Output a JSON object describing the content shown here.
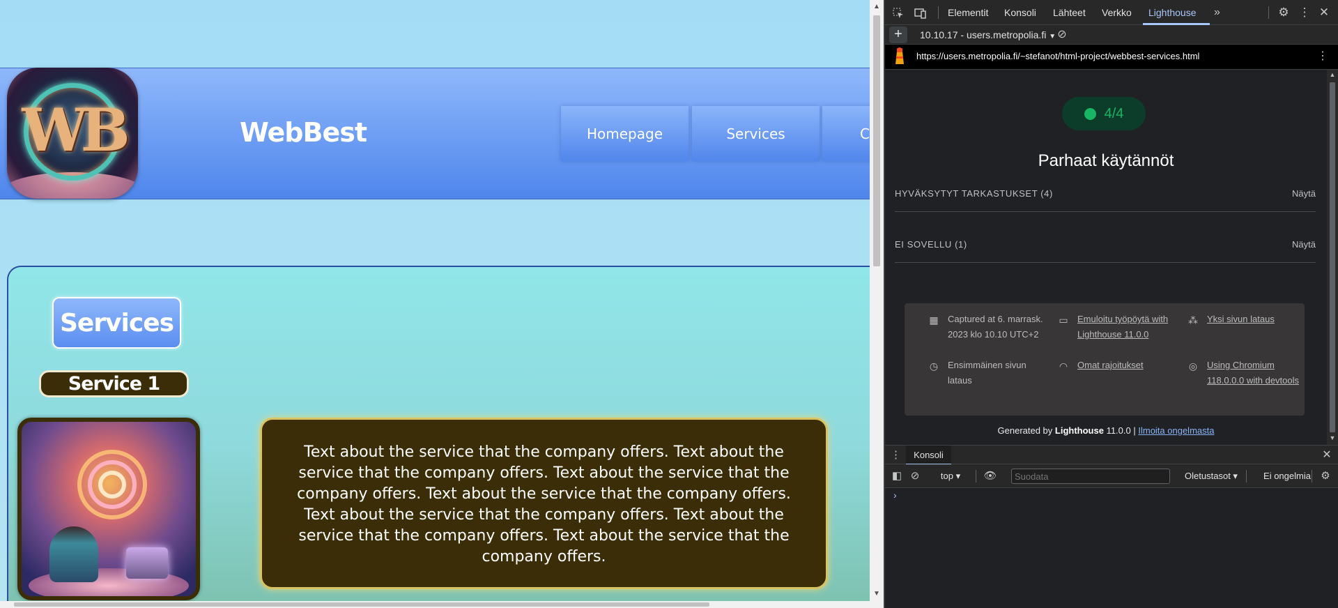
{
  "site": {
    "title": "WebBest",
    "logo_text": "WB",
    "nav": [
      {
        "label": "Homepage"
      },
      {
        "label": "Services"
      },
      {
        "label": "C"
      }
    ],
    "services_heading": "Services",
    "service1_heading": "Service 1",
    "service1_text": "Text about the service that the company offers. Text about the service that the company offers. Text about the service that the company offers. Text about the service that the company offers. Text about the service that the company offers. Text about the service that the company offers. Text about the service that the company offers."
  },
  "devtools": {
    "tabs": [
      {
        "label": "Elementit"
      },
      {
        "label": "Konsoli"
      },
      {
        "label": "Lähteet"
      },
      {
        "label": "Verkko"
      },
      {
        "label": "Lighthouse",
        "active": true
      }
    ],
    "more_tabs_glyph": "»",
    "icons": {
      "inspect": "inspect-element-icon",
      "device": "device-toolbar-icon",
      "settings": "gear-icon",
      "kebab": "kebab-menu-icon",
      "close": "close-icon"
    },
    "lighthouse": {
      "add_glyph": "+",
      "report_select": "10.10.17 - users.metropolia.fi",
      "url": "https://users.metropolia.fi/~stefanot/html-project/webbest-services.html",
      "score": "4/4",
      "score_color": "#18b663",
      "category_title": "Parhaat käytännöt",
      "audit_groups": [
        {
          "label": "HYVÄKSYTYT TARKASTUKSET (4)",
          "action": "Näytä"
        },
        {
          "label": "EI SOVELLU (1)",
          "action": "Näytä"
        }
      ],
      "environment": {
        "captured": "Captured at 6. marrask. 2023 klo 10.10 UTC+2",
        "emulated": "Emuloitu työpöytä with Lighthouse 11.0.0",
        "single": "Yksi sivun lataus",
        "initial": "Ensimmäinen sivun lataus",
        "throttling": "Omat rajoitukset",
        "chromium": "Using Chromium 118.0.0.0 with devtools"
      },
      "footer": {
        "prefix": "Generated by ",
        "brand": "Lighthouse",
        "version": " 11.0.0 | ",
        "link": "Ilmoita ongelmasta"
      }
    },
    "drawer": {
      "tab": "Konsoli",
      "context": "top ▾",
      "filter_placeholder": "Suodata",
      "levels": "Oletustasot ▾",
      "issues": "Ei ongelmia",
      "prompt": "›"
    }
  }
}
